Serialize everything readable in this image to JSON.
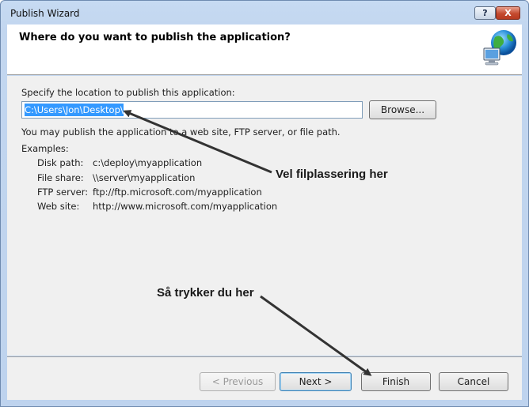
{
  "window": {
    "title": "Publish Wizard",
    "help_label": "?",
    "close_label": "X"
  },
  "header": {
    "title": "Where do you want to publish the application?",
    "icon": "globe-computer-icon"
  },
  "form": {
    "location_label": "Specify the location to publish this application:",
    "location_value": "C:\\Users\\Jon\\Desktop\\",
    "browse_label": "Browse...",
    "hint": "You may publish the application to a web site, FTP server, or file path.",
    "examples_heading": "Examples:",
    "examples": [
      {
        "kind": "Disk path:",
        "value": "c:\\deploy\\myapplication"
      },
      {
        "kind": "File share:",
        "value": "\\\\server\\myapplication"
      },
      {
        "kind": "FTP server:",
        "value": "ftp://ftp.microsoft.com/myapplication"
      },
      {
        "kind": "Web site:",
        "value": "http://www.microsoft.com/myapplication"
      }
    ]
  },
  "buttons": {
    "previous": "< Previous",
    "next": "Next >",
    "finish": "Finish",
    "cancel": "Cancel"
  },
  "annotations": {
    "location_note": "Vel filplassering her",
    "finish_note": "Så trykker du her"
  },
  "colors": {
    "selection": "#3399ff",
    "arrow": "#333333"
  }
}
